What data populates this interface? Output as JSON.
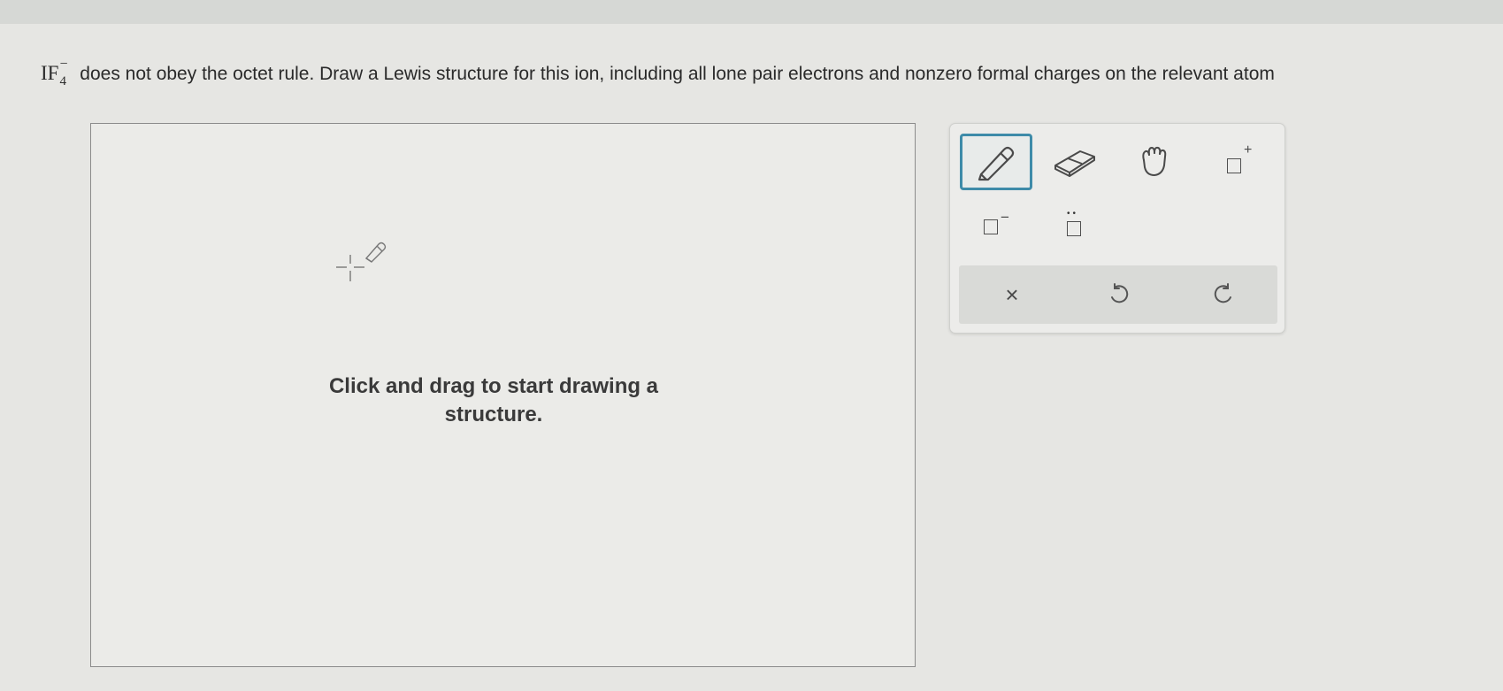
{
  "question": {
    "formula": {
      "base": "IF",
      "subscript": "4",
      "superscript": "−"
    },
    "text": "does not obey the octet rule. Draw a Lewis structure for this ion, including all lone pair electrons and nonzero formal charges on the relevant atom"
  },
  "canvas": {
    "hint": "Click and drag to start drawing a structure."
  },
  "toolbar": {
    "tools": [
      {
        "id": "draw",
        "icon": "pencil-icon",
        "active": true
      },
      {
        "id": "erase",
        "icon": "eraser-icon",
        "active": false
      },
      {
        "id": "move",
        "icon": "hand-icon",
        "active": false
      },
      {
        "id": "positive-charge",
        "icon": "positive-charge-icon",
        "label": "+"
      },
      {
        "id": "negative-charge",
        "icon": "negative-charge-icon",
        "label": "−"
      },
      {
        "id": "lone-pair",
        "icon": "lone-pair-icon",
        "label": "••"
      }
    ],
    "actions": [
      {
        "id": "clear",
        "icon": "clear-icon",
        "label": "×"
      },
      {
        "id": "undo",
        "icon": "undo-icon"
      },
      {
        "id": "redo",
        "icon": "redo-icon"
      }
    ]
  },
  "colors": {
    "accent": "#3e8ba9",
    "background": "#e6e6e3",
    "canvas_border": "#8b8b8b"
  }
}
